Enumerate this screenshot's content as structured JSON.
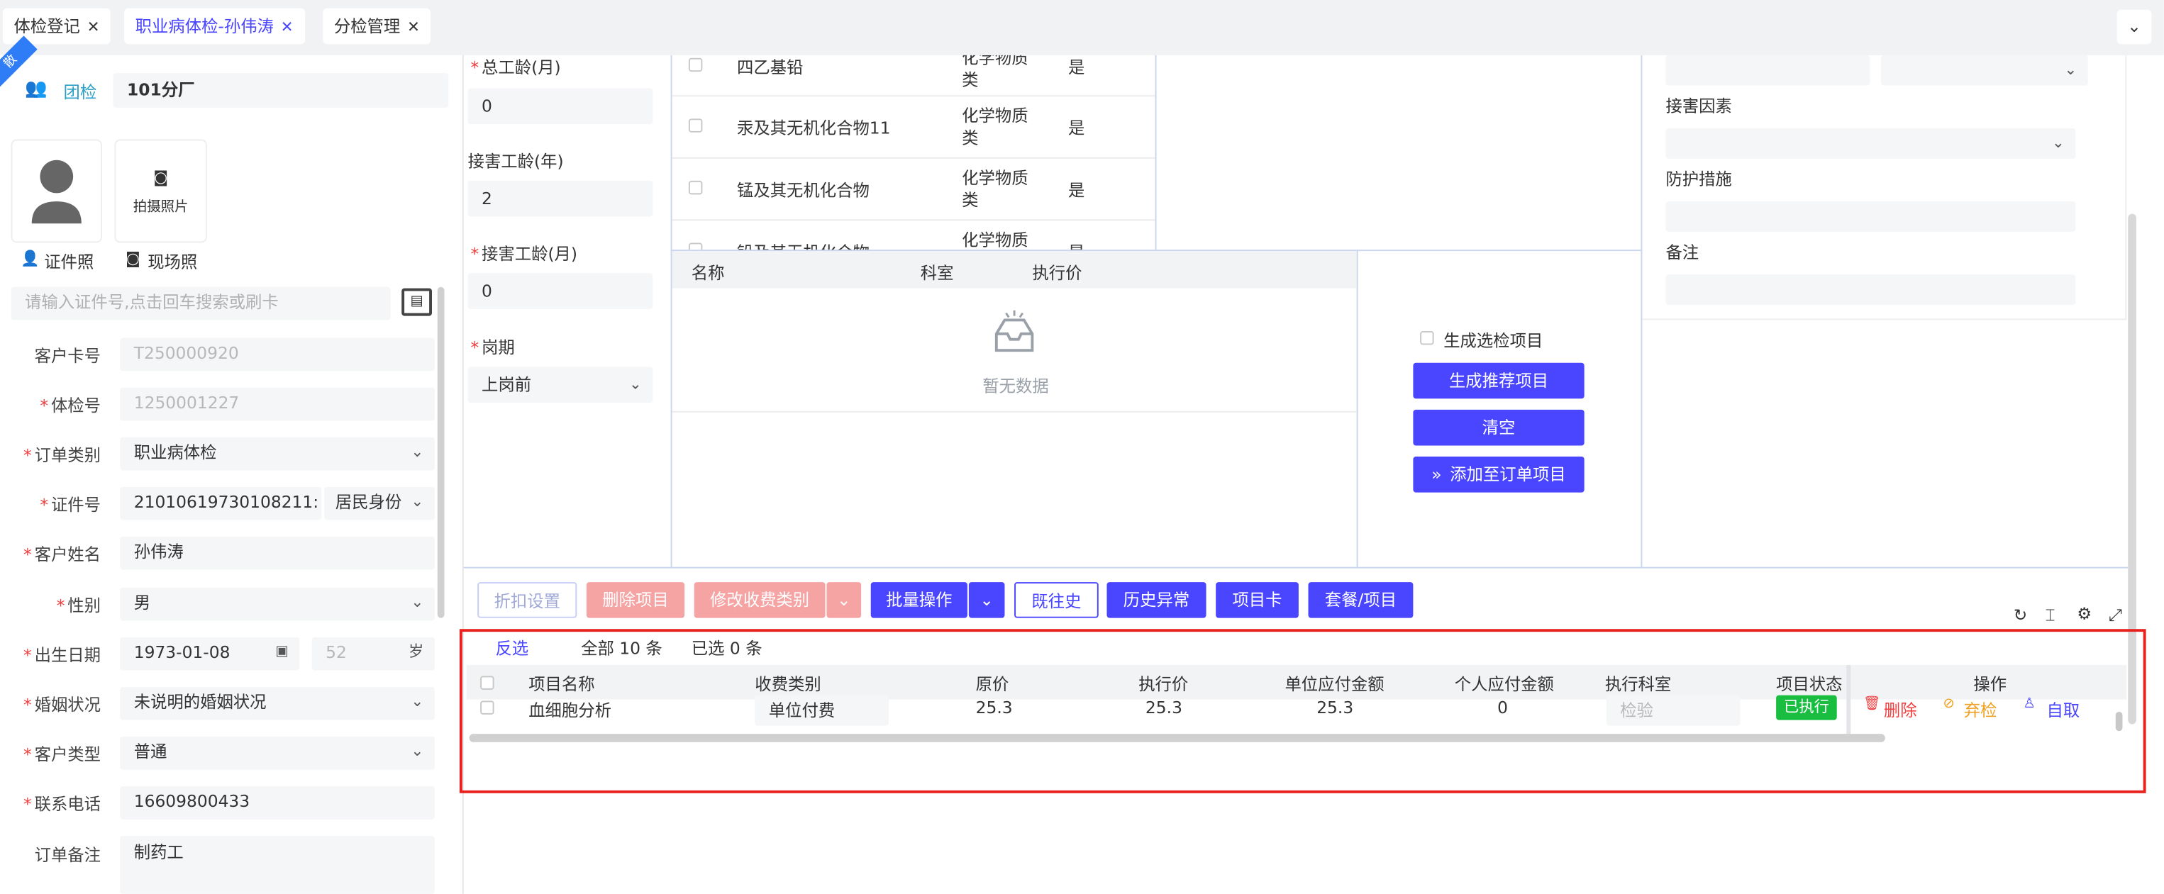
{
  "tabs": [
    {
      "label": "体检登记"
    },
    {
      "label": "职业病体检-孙伟涛"
    },
    {
      "label": "分检管理"
    }
  ],
  "header": {
    "corner_badge": "散",
    "group_label": "团检",
    "company": "101分厂"
  },
  "photo": {
    "take_photo_label": "拍摄照片",
    "id_photo_label": "证件照",
    "site_photo_label": "现场照"
  },
  "search": {
    "placeholder": "请输入证件号,点击回车搜索或刷卡"
  },
  "form": {
    "card_no": {
      "label": "客户卡号",
      "value": "T250000920"
    },
    "exam_no": {
      "label": "体检号",
      "value": "1250001227"
    },
    "order_type": {
      "label": "订单类别",
      "value": "职业病体检"
    },
    "id_no": {
      "label": "证件号",
      "value": "21010619730108211:",
      "id_type": "居民身份"
    },
    "name": {
      "label": "客户姓名",
      "value": "孙伟涛"
    },
    "gender": {
      "label": "性别",
      "value": "男"
    },
    "birth": {
      "label": "出生日期",
      "value": "1973-01-08",
      "age": "52",
      "age_unit": "岁"
    },
    "marital": {
      "label": "婚姻状况",
      "value": "未说明的婚姻状况"
    },
    "cust_type": {
      "label": "客户类型",
      "value": "普通"
    },
    "phone": {
      "label": "联系电话",
      "value": "16609800433"
    },
    "remark": {
      "label": "订单备注",
      "value": "制药工"
    }
  },
  "work": {
    "total_months": {
      "label": "总工龄(月)",
      "value": "0"
    },
    "exposure_years": {
      "label": "接害工龄(年)",
      "value": "2"
    },
    "exposure_months": {
      "label": "接害工龄(月)",
      "value": "0"
    },
    "period": {
      "label": "岗期",
      "value": "上岗前"
    }
  },
  "hazards": [
    {
      "name": "四乙基铅",
      "type": "化学物质类",
      "flag": "是"
    },
    {
      "name": "汞及其无机化合物11",
      "type": "化学物质类",
      "flag": "是"
    },
    {
      "name": "锰及其无机化合物",
      "type": "化学物质类",
      "flag": "是"
    },
    {
      "name": "铅及其无机化合物",
      "type": "化学物质类",
      "flag": "是"
    }
  ],
  "items_table": {
    "headers": [
      "名称",
      "科室",
      "执行价"
    ],
    "empty": "暂无数据"
  },
  "actions": {
    "gen_optional": "生成选检项目",
    "gen_recommend": "生成推荐项目",
    "clear": "清空",
    "add_to_order": "添加至订单项目"
  },
  "right": {
    "hazard_label": "接害因素",
    "protection_label": "防护措施",
    "remark_label": "备注"
  },
  "toolbar": {
    "discount": "折扣设置",
    "delete_item": "删除项目",
    "modify_fee": "修改收费类别",
    "batch": "批量操作",
    "history": "既往史",
    "abnormal": "历史异常",
    "item_card": "项目卡",
    "package": "套餐/项目"
  },
  "summary": {
    "invert": "反选",
    "total": "全部 10 条",
    "selected": "已选 0 条"
  },
  "order_table": {
    "headers": [
      "项目名称",
      "收费类别",
      "原价",
      "执行价",
      "单位应付金额",
      "个人应付金额",
      "执行科室",
      "项目状态",
      "操作"
    ],
    "rows": [
      {
        "name": "血细胞分析",
        "fee": "单位付费",
        "orig": "25.3",
        "exec": "25.3",
        "unit": "25.3",
        "personal": "0",
        "dept": "检验",
        "status": "已执行",
        "op_delete": "删除",
        "op_abandon": "弃检",
        "op_self": "自取"
      }
    ]
  },
  "colors": {
    "primary": "#4a45ff",
    "danger": "#f04040",
    "success": "#19be40",
    "warning": "#f0a020",
    "highlight": "#e8201e"
  }
}
